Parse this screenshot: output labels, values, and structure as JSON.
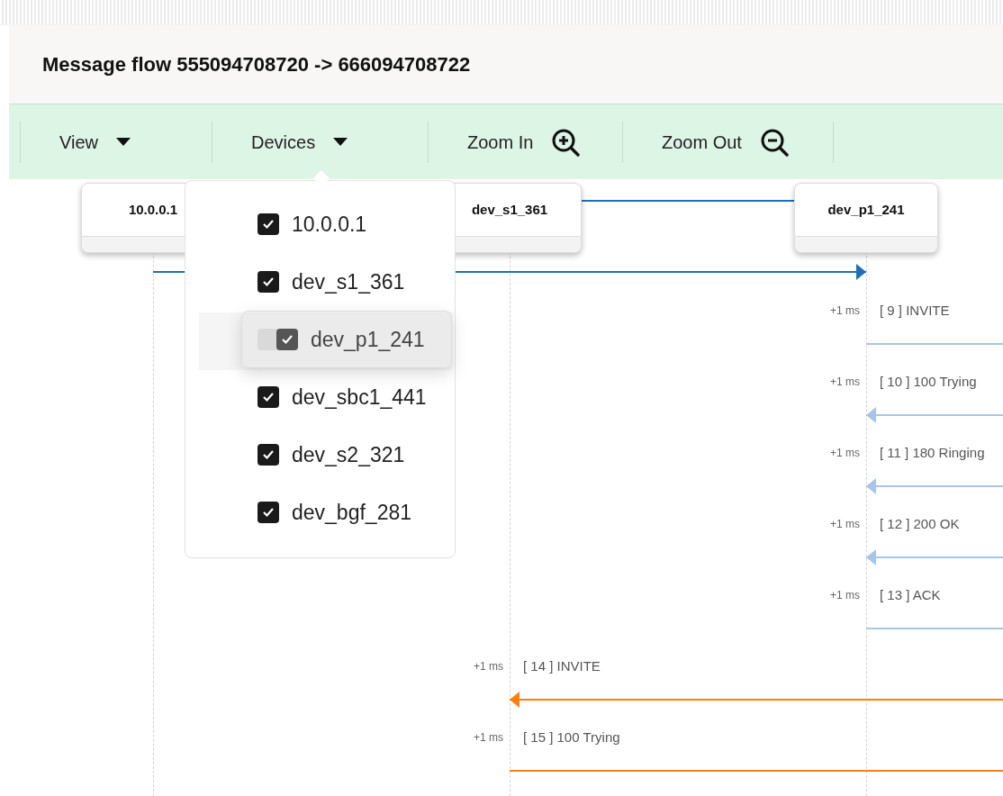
{
  "title": "Message flow 555094708720 -> 666094708722",
  "toolbar": [
    {
      "label": "View",
      "kind": "menu"
    },
    {
      "label": "Devices",
      "kind": "menu"
    },
    {
      "label": "Zoom In",
      "kind": "zoom-in"
    },
    {
      "label": "Zoom Out",
      "kind": "zoom-out"
    }
  ],
  "devices_menu": [
    {
      "label": "10.0.0.1",
      "checked": true,
      "dragging": false
    },
    {
      "label": "dev_s1_361",
      "checked": true,
      "dragging": false
    },
    {
      "label": "dev_p1_241",
      "checked": true,
      "dragging": true
    },
    {
      "label": "dev_sbc1_441",
      "checked": true,
      "dragging": false
    },
    {
      "label": "dev_s2_321",
      "checked": true,
      "dragging": false
    },
    {
      "label": "dev_bgf_281",
      "checked": true,
      "dragging": false
    }
  ],
  "lifelines": [
    "10.0.0.1",
    "dev_s1_361",
    "dev_p1_241"
  ],
  "partial_arrows": [
    {
      "kind": "line",
      "color": "#1f6fb5"
    },
    {
      "kind": "arrow",
      "color": "#1f6fb5"
    }
  ],
  "messages": [
    {
      "time": "+1 ms",
      "label": "[ 9 ] INVITE",
      "kind": "line",
      "color": "#a8c4e8"
    },
    {
      "time": "+1 ms",
      "label": "[ 10 ] 100 Trying",
      "kind": "arrow",
      "color": "#a8c4e8"
    },
    {
      "time": "+1 ms",
      "label": "[ 11 ] 180 Ringing",
      "kind": "arrow",
      "color": "#a8c4e8"
    },
    {
      "time": "+1 ms",
      "label": "[ 12 ] 200 OK",
      "kind": "arrow",
      "color": "#a8c4e8"
    },
    {
      "time": "+1 ms",
      "label": "[ 13 ] ACK",
      "kind": "line",
      "color": "#a8c4e8"
    },
    {
      "time": "+1 ms",
      "label": "[ 14 ] INVITE",
      "kind": "arrow",
      "color": "#ff7f0e"
    },
    {
      "time": "+1 ms",
      "label": "[ 15 ] 100 Trying",
      "kind": "line",
      "color": "#ff7f0e"
    }
  ]
}
